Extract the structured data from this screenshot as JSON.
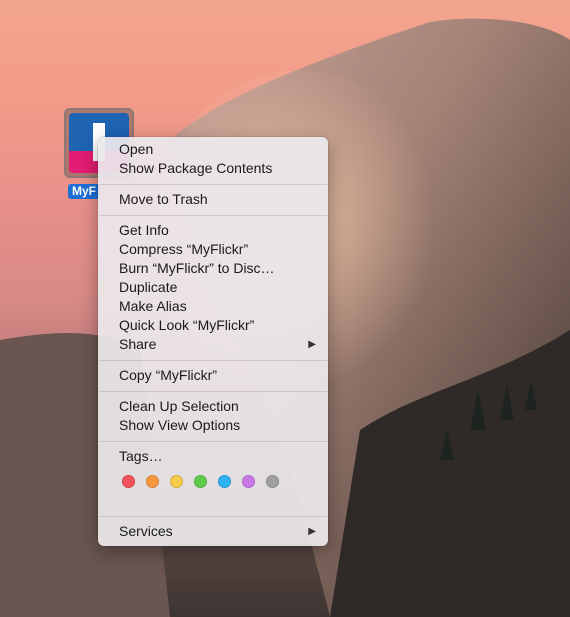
{
  "desktop": {
    "icon_label": "MyF"
  },
  "menu": {
    "open": "Open",
    "show_package_contents": "Show Package Contents",
    "move_to_trash": "Move to Trash",
    "get_info": "Get Info",
    "compress": "Compress “MyFlickr”",
    "burn": "Burn “MyFlickr” to Disc…",
    "duplicate": "Duplicate",
    "make_alias": "Make Alias",
    "quick_look": "Quick Look “MyFlickr”",
    "share": "Share",
    "copy": "Copy “MyFlickr”",
    "clean_up": "Clean Up Selection",
    "show_view_options": "Show View Options",
    "tags": "Tags…",
    "services": "Services"
  },
  "tag_colors": [
    "#f5535b",
    "#f7983d",
    "#f6cb4a",
    "#5fcb4c",
    "#2fb2f2",
    "#c979e6",
    "#a0a0a0"
  ],
  "icons": {
    "submenu": "chevron-right-icon"
  }
}
